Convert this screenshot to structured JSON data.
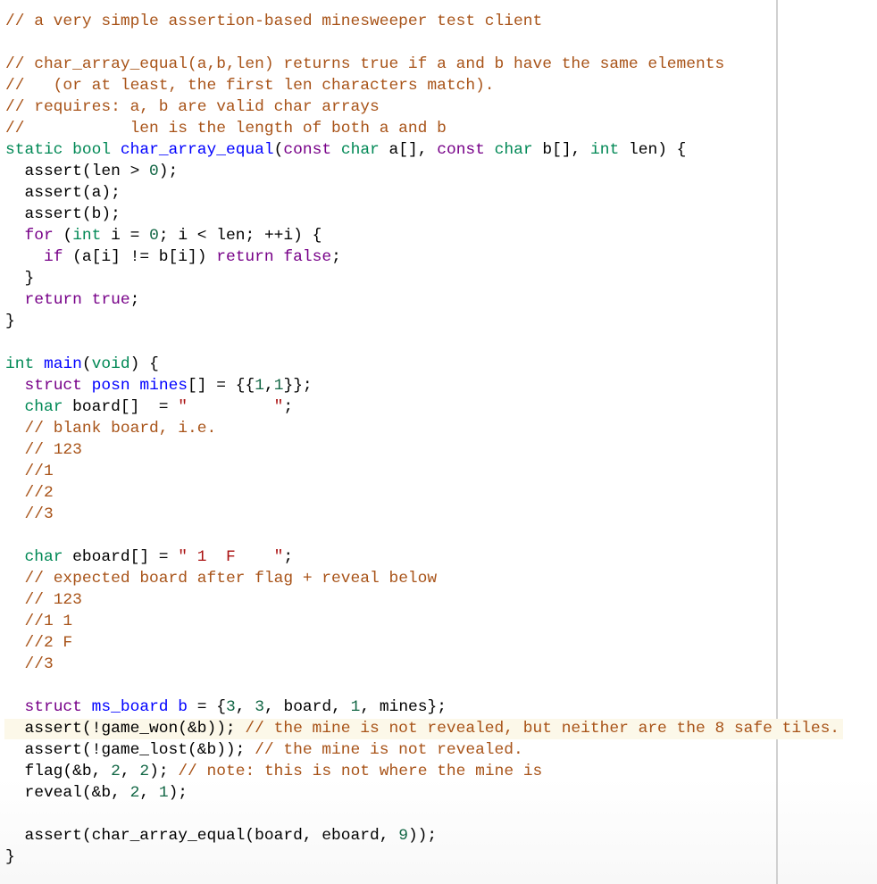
{
  "editor": {
    "language": "c",
    "active_line": 34,
    "colors": {
      "comment": "#a85318",
      "keyword": "#770088",
      "type": "#008855",
      "def": "#0000ff",
      "number": "#116644",
      "string": "#aa1111",
      "active_line_bg": "#fcf8e9",
      "ruler": "#d0d0d0"
    },
    "lines": [
      [
        {
          "t": "comment",
          "s": "// a very simple assertion-based minesweeper test client"
        }
      ],
      [],
      [
        {
          "t": "comment",
          "s": "// char_array_equal(a,b,len) returns true if a and b have the same elements"
        }
      ],
      [
        {
          "t": "comment",
          "s": "//   (or at least, the first len characters match)."
        }
      ],
      [
        {
          "t": "comment",
          "s": "// requires: a, b are valid char arrays"
        }
      ],
      [
        {
          "t": "comment",
          "s": "//           len is the length of both a and b"
        }
      ],
      [
        {
          "t": "type",
          "s": "static"
        },
        {
          "t": "",
          "s": " "
        },
        {
          "t": "type",
          "s": "bool"
        },
        {
          "t": "",
          "s": " "
        },
        {
          "t": "def",
          "s": "char_array_equal"
        },
        {
          "t": "",
          "s": "("
        },
        {
          "t": "keyword",
          "s": "const"
        },
        {
          "t": "",
          "s": " "
        },
        {
          "t": "type",
          "s": "char"
        },
        {
          "t": "",
          "s": " a[], "
        },
        {
          "t": "keyword",
          "s": "const"
        },
        {
          "t": "",
          "s": " "
        },
        {
          "t": "type",
          "s": "char"
        },
        {
          "t": "",
          "s": " b[], "
        },
        {
          "t": "type",
          "s": "int"
        },
        {
          "t": "",
          "s": " len) {"
        }
      ],
      [
        {
          "t": "",
          "s": "  assert(len > "
        },
        {
          "t": "number",
          "s": "0"
        },
        {
          "t": "",
          "s": ");"
        }
      ],
      [
        {
          "t": "",
          "s": "  assert(a);"
        }
      ],
      [
        {
          "t": "",
          "s": "  assert(b);"
        }
      ],
      [
        {
          "t": "",
          "s": "  "
        },
        {
          "t": "keyword",
          "s": "for"
        },
        {
          "t": "",
          "s": " ("
        },
        {
          "t": "type",
          "s": "int"
        },
        {
          "t": "",
          "s": " i = "
        },
        {
          "t": "number",
          "s": "0"
        },
        {
          "t": "",
          "s": "; i < len; ++i) {"
        }
      ],
      [
        {
          "t": "",
          "s": "    "
        },
        {
          "t": "keyword",
          "s": "if"
        },
        {
          "t": "",
          "s": " (a[i] != b[i]) "
        },
        {
          "t": "keyword",
          "s": "return"
        },
        {
          "t": "",
          "s": " "
        },
        {
          "t": "atom",
          "s": "false"
        },
        {
          "t": "",
          "s": ";"
        }
      ],
      [
        {
          "t": "",
          "s": "  }"
        }
      ],
      [
        {
          "t": "",
          "s": "  "
        },
        {
          "t": "keyword",
          "s": "return"
        },
        {
          "t": "",
          "s": " "
        },
        {
          "t": "atom",
          "s": "true"
        },
        {
          "t": "",
          "s": ";"
        }
      ],
      [
        {
          "t": "",
          "s": "}"
        }
      ],
      [],
      [
        {
          "t": "type",
          "s": "int"
        },
        {
          "t": "",
          "s": " "
        },
        {
          "t": "def",
          "s": "main"
        },
        {
          "t": "",
          "s": "("
        },
        {
          "t": "type",
          "s": "void"
        },
        {
          "t": "",
          "s": ") {"
        }
      ],
      [
        {
          "t": "",
          "s": "  "
        },
        {
          "t": "keyword",
          "s": "struct"
        },
        {
          "t": "",
          "s": " "
        },
        {
          "t": "def",
          "s": "posn"
        },
        {
          "t": "",
          "s": " "
        },
        {
          "t": "def",
          "s": "mines"
        },
        {
          "t": "",
          "s": "[] = {{"
        },
        {
          "t": "number",
          "s": "1"
        },
        {
          "t": "",
          "s": ","
        },
        {
          "t": "number",
          "s": "1"
        },
        {
          "t": "",
          "s": "}};"
        }
      ],
      [
        {
          "t": "",
          "s": "  "
        },
        {
          "t": "type",
          "s": "char"
        },
        {
          "t": "",
          "s": " board[]  = "
        },
        {
          "t": "string",
          "s": "\"         \""
        },
        {
          "t": "",
          "s": ";"
        }
      ],
      [
        {
          "t": "",
          "s": "  "
        },
        {
          "t": "comment",
          "s": "// blank board, i.e."
        }
      ],
      [
        {
          "t": "",
          "s": "  "
        },
        {
          "t": "comment",
          "s": "// 123"
        }
      ],
      [
        {
          "t": "",
          "s": "  "
        },
        {
          "t": "comment",
          "s": "//1"
        }
      ],
      [
        {
          "t": "",
          "s": "  "
        },
        {
          "t": "comment",
          "s": "//2"
        }
      ],
      [
        {
          "t": "",
          "s": "  "
        },
        {
          "t": "comment",
          "s": "//3"
        }
      ],
      [],
      [
        {
          "t": "",
          "s": "  "
        },
        {
          "t": "type",
          "s": "char"
        },
        {
          "t": "",
          "s": " eboard[] = "
        },
        {
          "t": "string",
          "s": "\" 1  F    \""
        },
        {
          "t": "",
          "s": ";"
        }
      ],
      [
        {
          "t": "",
          "s": "  "
        },
        {
          "t": "comment",
          "s": "// expected board after flag + reveal below"
        }
      ],
      [
        {
          "t": "",
          "s": "  "
        },
        {
          "t": "comment",
          "s": "// 123"
        }
      ],
      [
        {
          "t": "",
          "s": "  "
        },
        {
          "t": "comment",
          "s": "//1 1"
        }
      ],
      [
        {
          "t": "",
          "s": "  "
        },
        {
          "t": "comment",
          "s": "//2 F"
        }
      ],
      [
        {
          "t": "",
          "s": "  "
        },
        {
          "t": "comment",
          "s": "//3"
        }
      ],
      [],
      [
        {
          "t": "",
          "s": "  "
        },
        {
          "t": "keyword",
          "s": "struct"
        },
        {
          "t": "",
          "s": " "
        },
        {
          "t": "def",
          "s": "ms_board"
        },
        {
          "t": "",
          "s": " "
        },
        {
          "t": "def",
          "s": "b"
        },
        {
          "t": "",
          "s": " = {"
        },
        {
          "t": "number",
          "s": "3"
        },
        {
          "t": "",
          "s": ", "
        },
        {
          "t": "number",
          "s": "3"
        },
        {
          "t": "",
          "s": ", board, "
        },
        {
          "t": "number",
          "s": "1"
        },
        {
          "t": "",
          "s": ", mines};"
        }
      ],
      [
        {
          "t": "",
          "s": "  assert(!game_won(&b)); "
        },
        {
          "t": "comment",
          "s": "// the mine is not revealed, but neither are the 8 safe tiles."
        }
      ],
      [
        {
          "t": "",
          "s": "  assert(!game_lost(&b)); "
        },
        {
          "t": "comment",
          "s": "// the mine is not revealed."
        }
      ],
      [
        {
          "t": "",
          "s": "  flag(&b, "
        },
        {
          "t": "number",
          "s": "2"
        },
        {
          "t": "",
          "s": ", "
        },
        {
          "t": "number",
          "s": "2"
        },
        {
          "t": "",
          "s": "); "
        },
        {
          "t": "comment",
          "s": "// note: this is not where the mine is"
        }
      ],
      [
        {
          "t": "",
          "s": "  reveal(&b, "
        },
        {
          "t": "number",
          "s": "2"
        },
        {
          "t": "",
          "s": ", "
        },
        {
          "t": "number",
          "s": "1"
        },
        {
          "t": "",
          "s": ");"
        }
      ],
      [],
      [
        {
          "t": "",
          "s": "  assert(char_array_equal(board, eboard, "
        },
        {
          "t": "number",
          "s": "9"
        },
        {
          "t": "",
          "s": "));"
        }
      ],
      [
        {
          "t": "",
          "s": "}"
        }
      ]
    ]
  }
}
